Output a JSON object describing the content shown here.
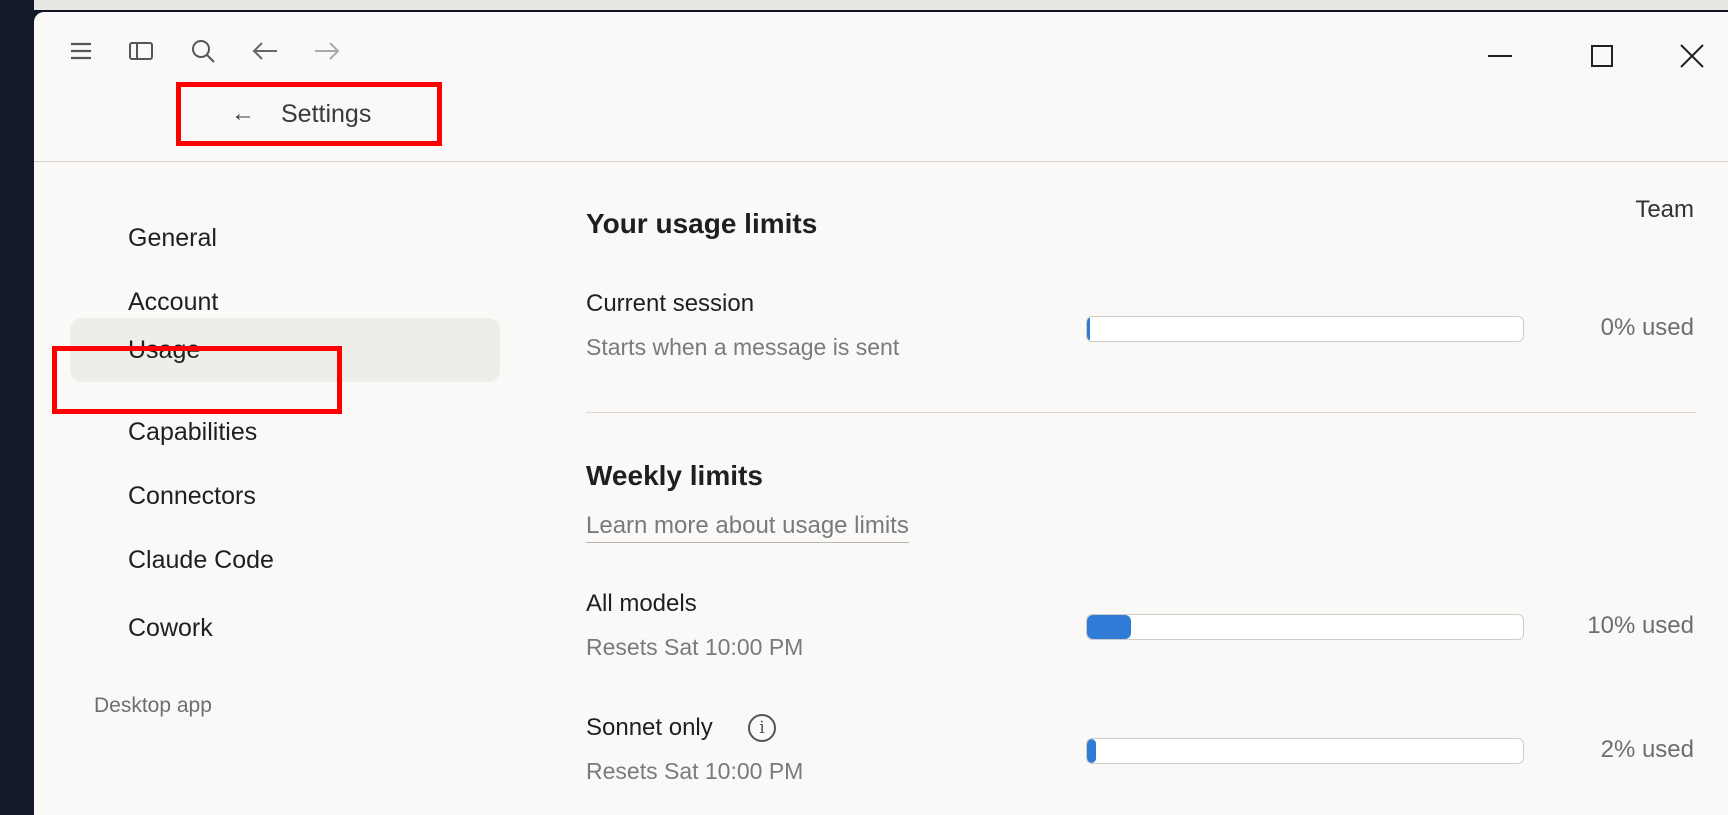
{
  "header": {
    "back_label": "Settings"
  },
  "window_controls": [
    "minimize-icon",
    "maximize-icon",
    "close-icon"
  ],
  "toolbar_icons": [
    "menu-icon",
    "sidebar-toggle-icon",
    "search-icon",
    "arrow-left-icon",
    "arrow-right-icon"
  ],
  "sidebar": {
    "items": [
      {
        "label": "General",
        "active": false
      },
      {
        "label": "Account",
        "active": false
      },
      {
        "label": "Usage",
        "active": true
      },
      {
        "label": "Capabilities",
        "active": false
      },
      {
        "label": "Connectors",
        "active": false
      },
      {
        "label": "Claude Code",
        "active": false
      },
      {
        "label": "Cowork",
        "active": false
      }
    ],
    "footer": "Desktop app"
  },
  "usage": {
    "title": "Your usage limits",
    "plan": "Team",
    "current_session": {
      "title": "Current session",
      "subtitle": "Starts when a message is sent",
      "percent": 0,
      "label": "0% used"
    },
    "weekly": {
      "title": "Weekly limits",
      "learn_more": "Learn more about usage limits",
      "all_models": {
        "title": "All models",
        "subtitle": "Resets Sat 10:00 PM",
        "percent": 10,
        "label": "10% used"
      },
      "sonnet_only": {
        "title": "Sonnet only",
        "subtitle": "Resets Sat 10:00 PM",
        "percent": 2,
        "label": "2% used"
      }
    }
  },
  "colors": {
    "bar_fill": "#2f7bd6",
    "highlight": "#ff0000"
  }
}
